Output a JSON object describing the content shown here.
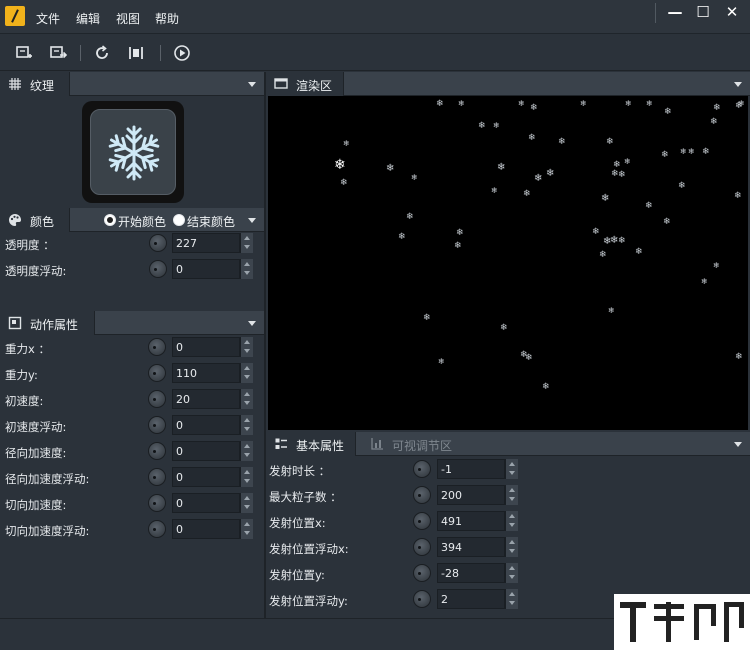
{
  "menu": {
    "items": [
      "文件",
      "编辑",
      "视图",
      "帮助"
    ]
  },
  "window_controls": {
    "minimize": "—",
    "maximize": "☐",
    "close": "✕"
  },
  "toolbar": {
    "buttons": [
      "new-emitter-icon",
      "export-icon",
      "refresh-icon",
      "fit-icon",
      "play-icon"
    ]
  },
  "texture_panel": {
    "title": "纹理",
    "icon": "texture-grid-icon",
    "preview_icon": "snowflake-icon"
  },
  "color_panel": {
    "title": "颜色",
    "icon": "palette-icon",
    "radio_start": "开始颜色",
    "radio_end": "结束颜色",
    "selected": "开始颜色",
    "rows": [
      {
        "label": "透明度 ：",
        "value": "227"
      },
      {
        "label": "透明度浮动:",
        "value": "0"
      }
    ]
  },
  "motion_panel": {
    "title": "动作属性",
    "icon": "motion-icon",
    "rows": [
      {
        "label": "重力x ：",
        "value": "0"
      },
      {
        "label": "重力y:",
        "value": "110"
      },
      {
        "label": "初速度:",
        "value": "20"
      },
      {
        "label": "初速度浮动:",
        "value": "0"
      },
      {
        "label": "径向加速度:",
        "value": "0"
      },
      {
        "label": "径向加速度浮动:",
        "value": "0"
      },
      {
        "label": "切向加速度:",
        "value": "0"
      },
      {
        "label": "切向加速度浮动:",
        "value": "0"
      }
    ]
  },
  "render_panel": {
    "title": "渲染区",
    "icon": "monitor-icon"
  },
  "basic_panel": {
    "tab_active": "基本属性",
    "tab_inactive": "可视调节区",
    "rows": [
      {
        "label": "发射时长 ：",
        "value": "-1"
      },
      {
        "label": "最大粒子数 ：",
        "value": "200"
      },
      {
        "label": "发射位置x:",
        "value": "491"
      },
      {
        "label": "发射位置浮动x:",
        "value": "394"
      },
      {
        "label": "发射位置y:",
        "value": "-28"
      },
      {
        "label": "发射位置浮动y:",
        "value": "2"
      }
    ]
  },
  "colors": {
    "accent": "#f1b21b",
    "panel": "#2b323a",
    "header": "#3a424b"
  }
}
